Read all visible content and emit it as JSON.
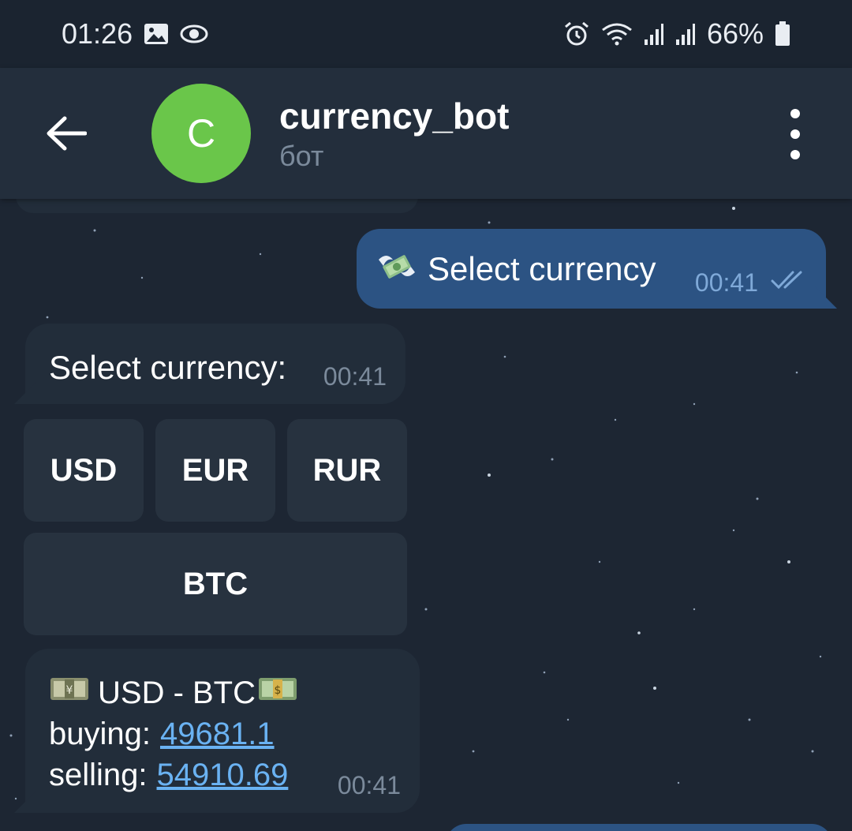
{
  "status_bar": {
    "time": "01:26",
    "battery": "66%"
  },
  "header": {
    "avatar_letter": "C",
    "title": "currency_bot",
    "subtitle": "бот"
  },
  "messages": {
    "outgoing": {
      "text": "Select currency",
      "time": "00:41"
    },
    "prompt": {
      "text": "Select currency:",
      "time": "00:41"
    },
    "keyboard": [
      "USD",
      "EUR",
      "RUR",
      "BTC"
    ],
    "result": {
      "pair": "USD - BTC",
      "buying_label": "buying:",
      "buying_value": "49681.1",
      "selling_label": "selling:",
      "selling_value": "54910.69",
      "time": "00:41"
    }
  },
  "colors": {
    "avatar": "#6ac64a",
    "outgoing_bubble": "#2c5383",
    "incoming_bubble": "#222d3a",
    "link": "#6ab2f2"
  }
}
